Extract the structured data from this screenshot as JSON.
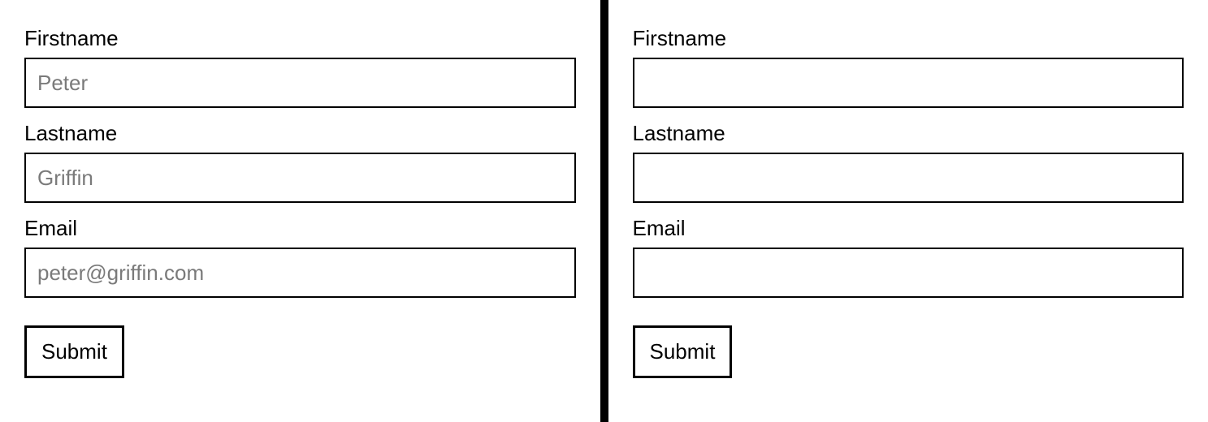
{
  "left": {
    "firstname": {
      "label": "Firstname",
      "placeholder": "Peter",
      "value": ""
    },
    "lastname": {
      "label": "Lastname",
      "placeholder": "Griffin",
      "value": ""
    },
    "email": {
      "label": "Email",
      "placeholder": "peter@griffin.com",
      "value": ""
    },
    "submit_label": "Submit"
  },
  "right": {
    "firstname": {
      "label": "Firstname",
      "placeholder": "",
      "value": ""
    },
    "lastname": {
      "label": "Lastname",
      "placeholder": "",
      "value": ""
    },
    "email": {
      "label": "Email",
      "placeholder": "",
      "value": ""
    },
    "submit_label": "Submit"
  }
}
